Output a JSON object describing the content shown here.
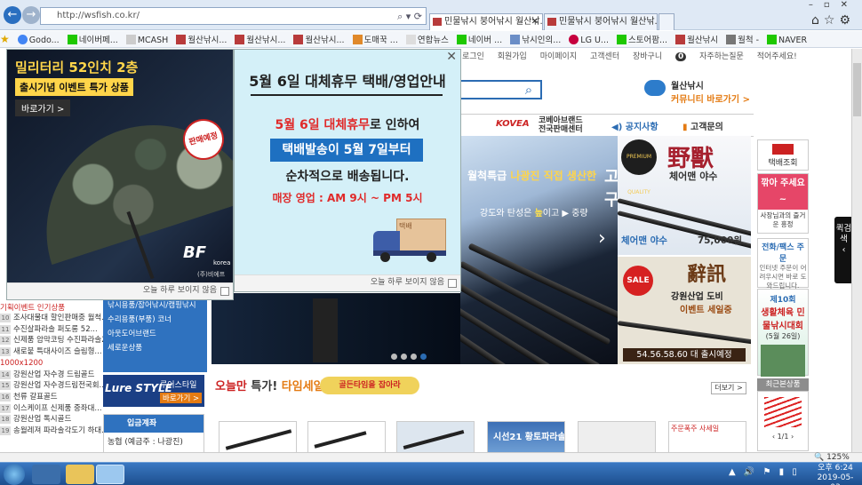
{
  "browser": {
    "url": "http://wsfish.co.kr/",
    "tabs": [
      "민물낚시 붕어낚시 월산낚...",
      "민물낚시 붕어낚시 월산낚..."
    ],
    "bookmarks": [
      "Godo...",
      "네이버페...",
      "MCASH",
      "월산낚시...",
      "월산낚시...",
      "월산낚시...",
      "도매꾹 ...",
      "연합뉴스",
      "네이버 ...",
      "낚시인의...",
      "LG U...",
      "스토어팜...",
      "월산낚시",
      "월척 -",
      "NAVER"
    ]
  },
  "popup_left": {
    "headline": "밀리터리 52인치 2층",
    "badge": "출시기념 이벤트 특가 상품",
    "button": "바로가기 >",
    "stamp": "판매예정",
    "brand": "BF",
    "brand_sub": "korea",
    "brand_sub2": "(주)비에프",
    "dismiss": "오늘 하루 보이지 않음"
  },
  "popup_notice": {
    "title": "5월 6일 대체휴무 택배/영업안내",
    "line1_red": "5월 6일 대체휴무",
    "line1_rest": "로 인하여",
    "line2": "택배발송이 5월 7일부터",
    "line3": "순차적으로 배송됩니다.",
    "line4": "매장 영업 : AM 9시 ~ PM 5시",
    "truck_label": "택배",
    "close": "✕",
    "dismiss": "오늘 하루 보이지 않음"
  },
  "site": {
    "top_links": [
      "로그인",
      "회원가입",
      "마이페이지",
      "고객센터",
      "장바구니",
      "자주하는질문",
      "적어주세요!"
    ],
    "cart_count": "0",
    "community_title": "월산낚시",
    "community_link": "커뮤니티 바로가기 >",
    "menu": [
      "KOVEA",
      "코베아브랜드 전국판매센터",
      "공지사항",
      "고객문의"
    ],
    "banner_title_pre": "월척특급 ",
    "banner_title_hl": "나광진 직접 생산한",
    "banner_title_post": " 고구",
    "banner_sub_pre": "강도와 탄성은 ",
    "banner_sub_hl": "높",
    "banner_sub_post": "이고 ▶ 중량",
    "side1_ch": "野獸",
    "side1_name": "체어맨 야수",
    "side1_badge": "PREMIUM QUALITY",
    "side1_price_name": "체어맨 야수",
    "side1_price": "75,000원",
    "side2_sale": "SALE",
    "side2_ch": "辭訊",
    "side2_name": "강원산업 도비",
    "side2_event": "이벤트 세일중",
    "side2_bottom": "54.56.58.60 대 출시예정",
    "right_col": {
      "delivery": "택배조회",
      "pink": "깎아 주세요~",
      "pink_sub": "사장님과의 즐거운 흥정",
      "phone_title": "전화/팩스 주문",
      "phone_sub": "인터넷 주문이 어려우시면 바로 도와드립니다.",
      "event_title": "제10회",
      "event_name": "생활체육 민물낚시대회",
      "event_date": "(5월 26일)",
      "recent_label": "최근본상품",
      "recent_page": "1/1"
    },
    "floating_tab": "퀵검색",
    "left_red": "기획이벤트 인기상품",
    "left_list": [
      {
        "n": "10",
        "t": "조사대물대 할인판매중 월척..."
      },
      {
        "n": "11",
        "t": "수진살파라솔 퍼도롱 52..."
      },
      {
        "n": "12",
        "t": "신제품 암막코팅 수진파라솔2층"
      },
      {
        "n": "13",
        "t": "새로붙 특대사이즈 슬림형..."
      },
      {
        "n": "",
        "t": "1000x1200"
      },
      {
        "n": "14",
        "t": "강원산업 자수경 드림골드"
      },
      {
        "n": "15",
        "t": "강원산업 자수경드림전국회..."
      },
      {
        "n": "16",
        "t": "천류 갈표골드"
      },
      {
        "n": "17",
        "t": "이스케이프 신제품 중좌대..."
      },
      {
        "n": "18",
        "t": "강원산업 톡시골드"
      },
      {
        "n": "19",
        "t": "송월레져 파라솔각도기 하대..."
      }
    ],
    "cat_menu": [
      "낚시용품/잡어낚시/캠핑낚시",
      "수리용품(부품) 코너",
      "아웃도어브랜드",
      "세로운상품"
    ],
    "lure_brand": "Lure STYLE",
    "lure_title": "루어스타일",
    "lure_link": "바로가기 >",
    "deposit_title": "입금계좌",
    "deposit_body": "농협 (예금주 : 나광진)",
    "today_pre": "오늘만",
    "today_mid": " 특가! ",
    "today_post": "타임세일",
    "today_btn": "골든타임을 잡아라",
    "more": "더보기 >",
    "product_tile": "시선21 황토파라솔 47",
    "product_tile2": "주문폭주 사세일"
  },
  "system": {
    "zoom": "125%",
    "time": "오후 6:24",
    "date": "2019-05-03"
  }
}
